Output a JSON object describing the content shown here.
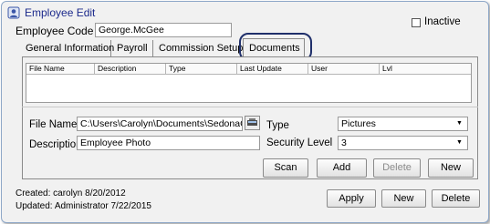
{
  "window": {
    "title": "Employee Edit"
  },
  "header": {
    "employee_code_label": "Employee Code",
    "employee_code_value": "George.McGee",
    "inactive_label": "Inactive",
    "inactive_checked": false
  },
  "tabs": [
    {
      "label": "General Information"
    },
    {
      "label": "Payroll"
    },
    {
      "label": "Commission Setup"
    },
    {
      "label": "Documents",
      "active": true
    }
  ],
  "documents": {
    "columns": [
      "File Name",
      "Description",
      "Type",
      "Last Update",
      "User",
      "Lvl"
    ],
    "rows": [],
    "file_name_label": "File Name",
    "file_name_value": "C:\\Users\\Carolyn\\Documents\\SedonaC",
    "description_label": "Description",
    "description_value": "Employee Photo",
    "type_label": "Type",
    "type_value": "Pictures",
    "security_level_label": "Security Level",
    "security_level_value": "3",
    "buttons": {
      "scan": "Scan",
      "add": "Add",
      "delete": "Delete",
      "new": "New"
    }
  },
  "footer": {
    "created": "Created: carolyn 8/20/2012",
    "updated": "Updated: Administrator 7/22/2015",
    "buttons": {
      "apply": "Apply",
      "new": "New",
      "delete": "Delete"
    }
  },
  "colors": {
    "title": "#1c2a8c",
    "highlight_ring": "#1f2f6a",
    "frame": "#8fa8c8"
  }
}
